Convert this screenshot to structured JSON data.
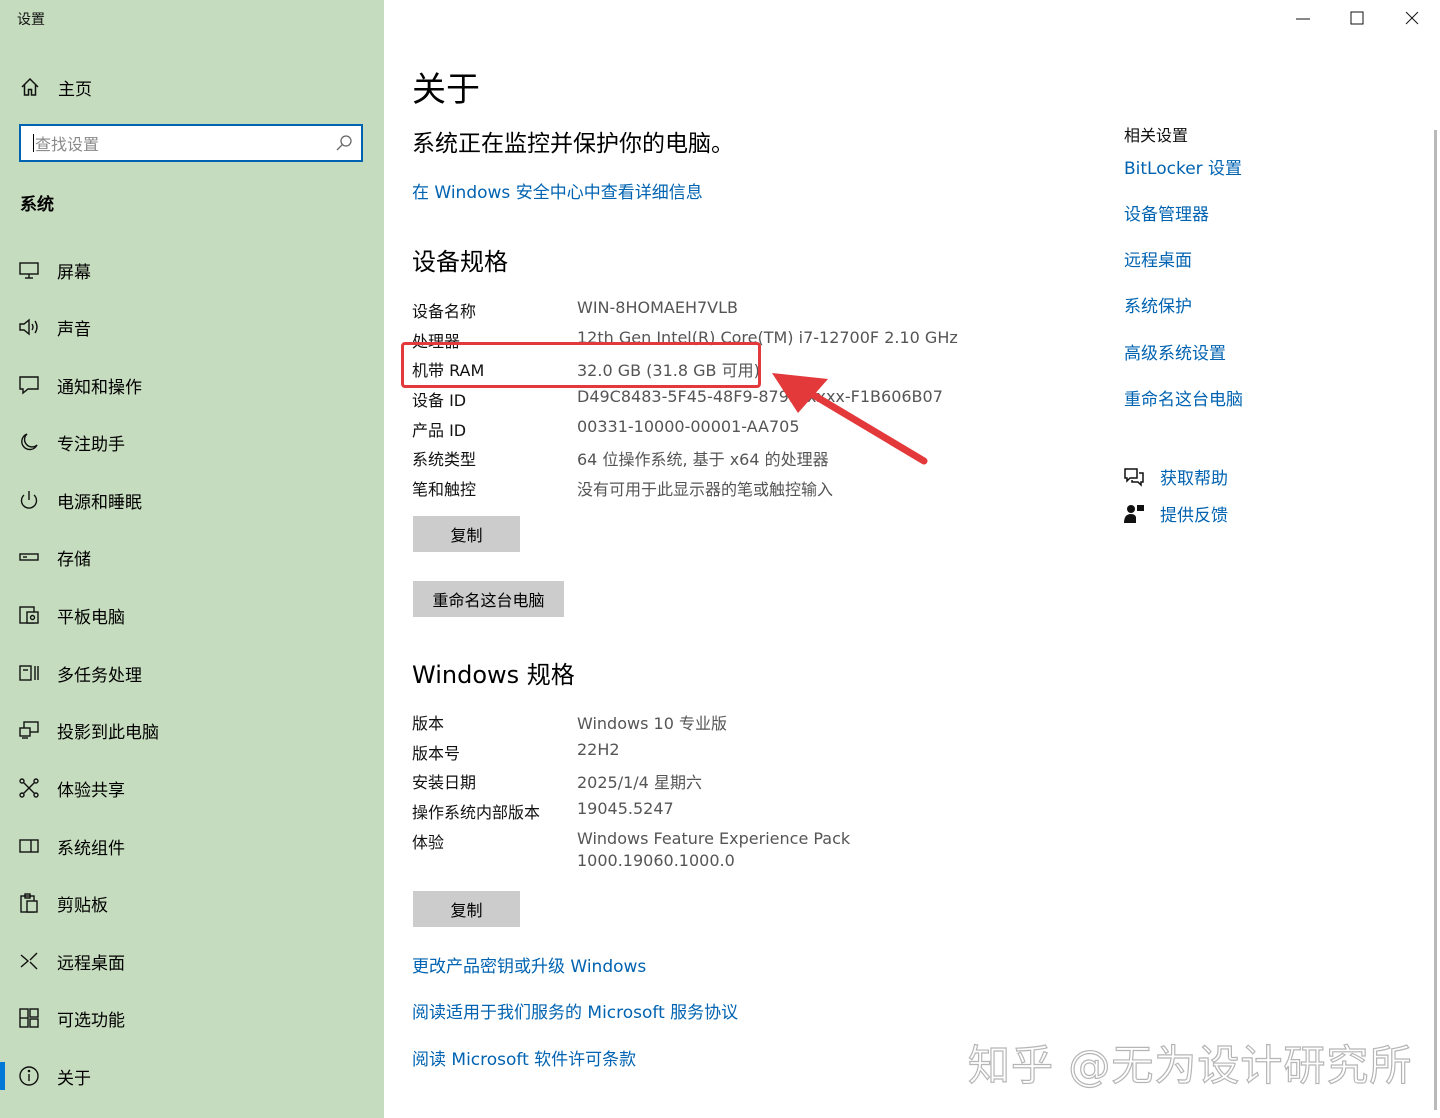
{
  "window": {
    "title": "设置"
  },
  "sidebar": {
    "home_label": "主页",
    "search_placeholder": "查找设置",
    "section_title": "系统",
    "items": [
      {
        "label": "屏幕",
        "icon": "monitor-icon"
      },
      {
        "label": "声音",
        "icon": "speaker-icon"
      },
      {
        "label": "通知和操作",
        "icon": "notification-icon"
      },
      {
        "label": "专注助手",
        "icon": "moon-icon"
      },
      {
        "label": "电源和睡眠",
        "icon": "power-icon"
      },
      {
        "label": "存储",
        "icon": "storage-icon"
      },
      {
        "label": "平板电脑",
        "icon": "tablet-icon"
      },
      {
        "label": "多任务处理",
        "icon": "multitask-icon"
      },
      {
        "label": "投影到此电脑",
        "icon": "project-icon"
      },
      {
        "label": "体验共享",
        "icon": "share-icon"
      },
      {
        "label": "系统组件",
        "icon": "components-icon"
      },
      {
        "label": "剪贴板",
        "icon": "clipboard-icon"
      },
      {
        "label": "远程桌面",
        "icon": "remote-icon"
      },
      {
        "label": "可选功能",
        "icon": "optional-features-icon"
      },
      {
        "label": "关于",
        "icon": "info-icon",
        "active": true
      }
    ]
  },
  "main": {
    "title": "关于",
    "status": "系统正在监控并保护你的电脑。",
    "security_link": "在 Windows 安全中心中查看详细信息",
    "device_specs": {
      "heading": "设备规格",
      "rows": [
        {
          "key": "设备名称",
          "value": "WIN-8HOMAEH7VLB"
        },
        {
          "key": "处理器",
          "value": "12th Gen Intel(R) Core(TM) i7-12700F   2.10 GHz"
        },
        {
          "key": "机带 RAM",
          "value": "32.0 GB (31.8 GB 可用)"
        },
        {
          "key": "设备 ID",
          "value": "D49C8483-5F45-48F9-879D-xxxx-F1B606B07"
        },
        {
          "key": "产品 ID",
          "value": "00331-10000-00001-AA705"
        },
        {
          "key": "系统类型",
          "value": "64 位操作系统, 基于 x64 的处理器"
        },
        {
          "key": "笔和触控",
          "value": "没有可用于此显示器的笔或触控输入"
        }
      ],
      "copy_button": "复制",
      "rename_button": "重命名这台电脑"
    },
    "windows_specs": {
      "heading": "Windows 规格",
      "rows": [
        {
          "key": "版本",
          "value": "Windows 10 专业版"
        },
        {
          "key": "版本号",
          "value": "22H2"
        },
        {
          "key": "安装日期",
          "value": "2025/1/4 星期六"
        },
        {
          "key": "操作系统内部版本",
          "value": "19045.5247"
        },
        {
          "key": "体验",
          "value": "Windows Feature Experience Pack",
          "value2": "1000.19060.1000.0"
        }
      ],
      "copy_button": "复制"
    },
    "links": [
      "更改产品密钥或升级 Windows",
      "阅读适用于我们服务的 Microsoft 服务协议",
      "阅读 Microsoft 软件许可条款"
    ]
  },
  "related": {
    "title": "相关设置",
    "links": [
      "BitLocker 设置",
      "设备管理器",
      "远程桌面",
      "系统保护",
      "高级系统设置",
      "重命名这台电脑"
    ],
    "get_help": "获取帮助",
    "feedback": "提供反馈"
  },
  "watermark": "知乎 @无为设计研究所",
  "colors": {
    "sidebar_bg": "#c6dcbe",
    "accent": "#0063b1",
    "annotation": "#e3393a"
  }
}
